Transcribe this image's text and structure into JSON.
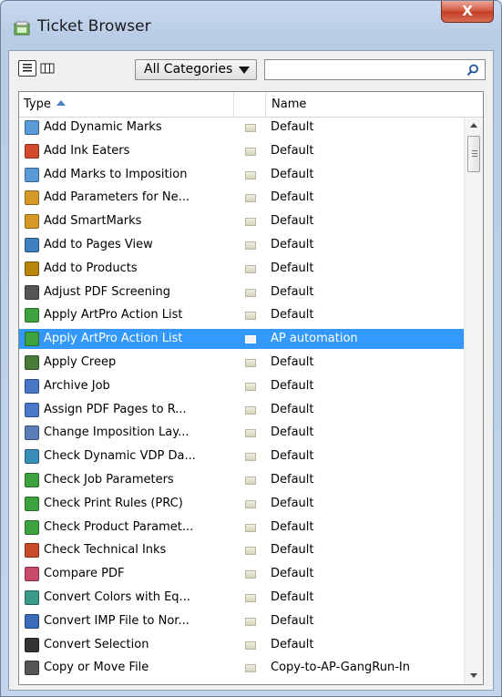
{
  "window": {
    "title": "Ticket Browser",
    "close_label": "X"
  },
  "toolbar": {
    "category_selected": "All Categories",
    "search_value": ""
  },
  "table": {
    "columns": [
      {
        "label": "Type"
      },
      {
        "label": ""
      },
      {
        "label": "Name"
      }
    ],
    "rows": [
      {
        "type": "Add Dynamic Marks",
        "name": "Default",
        "icon": "dynamic-marks-icon",
        "color": "#5a9ad6"
      },
      {
        "type": "Add Ink Eaters",
        "name": "Default",
        "icon": "ink-eaters-icon",
        "color": "#d24a2b"
      },
      {
        "type": "Add Marks to Imposition",
        "name": "Default",
        "icon": "marks-imposition-icon",
        "color": "#5a9ad6"
      },
      {
        "type": "Add Parameters for Ne...",
        "name": "Default",
        "icon": "parameters-icon",
        "color": "#d79a28"
      },
      {
        "type": "Add SmartMarks",
        "name": "Default",
        "icon": "smartmarks-icon",
        "color": "#d79a28"
      },
      {
        "type": "Add to Pages View",
        "name": "Default",
        "icon": "pages-view-icon",
        "color": "#3f7fbf"
      },
      {
        "type": "Add to Products",
        "name": "Default",
        "icon": "products-icon",
        "color": "#b8860b"
      },
      {
        "type": "Adjust PDF Screening",
        "name": "Default",
        "icon": "screening-icon",
        "color": "#555555"
      },
      {
        "type": "Apply ArtPro Action List",
        "name": "Default",
        "icon": "artpro-icon",
        "color": "#3ea33e"
      },
      {
        "type": "Apply ArtPro Action List",
        "name": "AP automation",
        "icon": "artpro-icon",
        "color": "#3ea33e",
        "selected": true
      },
      {
        "type": "Apply Creep",
        "name": "Default",
        "icon": "creep-icon",
        "color": "#4a7a3a"
      },
      {
        "type": "Archive Job",
        "name": "Default",
        "icon": "archive-icon",
        "color": "#4a78c8"
      },
      {
        "type": "Assign PDF Pages to R...",
        "name": "Default",
        "icon": "assign-pages-icon",
        "color": "#4a78c8"
      },
      {
        "type": "Change Imposition Lay...",
        "name": "Default",
        "icon": "imposition-layout-icon",
        "color": "#5a7fb8"
      },
      {
        "type": "Check Dynamic VDP Da...",
        "name": "Default",
        "icon": "vdp-check-icon",
        "color": "#3a8fb8"
      },
      {
        "type": "Check Job Parameters",
        "name": "Default",
        "icon": "job-parameters-icon",
        "color": "#3ea33e"
      },
      {
        "type": "Check Print Rules (PRC)",
        "name": "Default",
        "icon": "print-rules-icon",
        "color": "#3ea33e"
      },
      {
        "type": "Check Product Paramet...",
        "name": "Default",
        "icon": "product-parameters-icon",
        "color": "#3ea33e"
      },
      {
        "type": "Check Technical Inks",
        "name": "Default",
        "icon": "technical-inks-icon",
        "color": "#c84a2b"
      },
      {
        "type": "Compare PDF",
        "name": "Default",
        "icon": "compare-pdf-icon",
        "color": "#c84a6b"
      },
      {
        "type": "Convert Colors with Eq...",
        "name": "Default",
        "icon": "convert-colors-icon",
        "color": "#3a9a8a"
      },
      {
        "type": "Convert IMP File to Nor...",
        "name": "Default",
        "icon": "convert-imp-icon",
        "color": "#3a6ab8"
      },
      {
        "type": "Convert Selection",
        "name": "Default",
        "icon": "cursor-icon",
        "color": "#333333"
      },
      {
        "type": "Copy or Move File",
        "name": "Copy-to-AP-GangRun-In",
        "icon": "copy-file-icon",
        "color": "#555555"
      }
    ]
  }
}
